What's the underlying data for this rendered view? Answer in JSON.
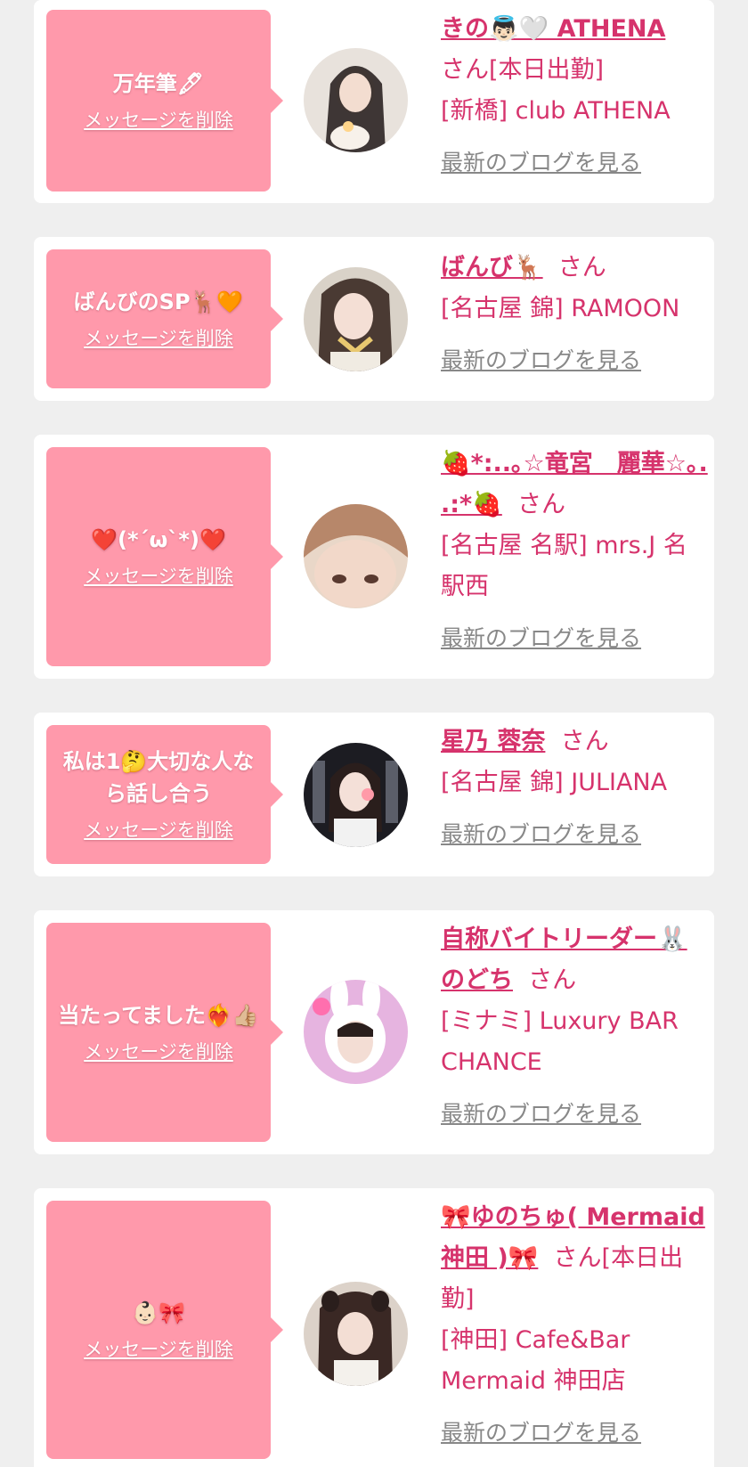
{
  "delete_label": "メッセージを削除",
  "blog_label": "最新のブログを見る",
  "colors": {
    "accent": "#d6336c",
    "bubble": "#ff99ab",
    "background": "#efefef",
    "link_gray": "#888888"
  },
  "entries": [
    {
      "message": "万年筆🖋",
      "name": "きの👼🏻🤍 ATHENA",
      "suffix": "さん[本日出勤]",
      "shop": "[新橋] club ATHENA"
    },
    {
      "message": "ばんびのSP🦌🧡",
      "name": "ばんび🦌",
      "suffix": "さん",
      "shop": "[名古屋 錦] RAMOON"
    },
    {
      "message": "❤️(*´ω`*)❤️",
      "name": "🍓*:..｡☆竜宮　麗華☆｡. .:*🍓",
      "suffix": "さん",
      "shop": "[名古屋 名駅] mrs.J 名駅西"
    },
    {
      "message": "私は1🤔大切な人なら話し合う",
      "name": "星乃 蓉奈",
      "suffix": "さん",
      "shop": "[名古屋 錦] JULIANA"
    },
    {
      "message": "当たってました❤️‍🔥👍🏼",
      "name": "自称バイトリーダー🐰のどち",
      "suffix": "さん",
      "shop": "[ミナミ] Luxury BAR CHANCE"
    },
    {
      "message": "👶🏻🎀",
      "name": "🎀ゆのちゅ( Mermaid 神田 )🎀",
      "suffix": "さん[本日出勤]",
      "shop": "[神田] Cafe&Bar Mermaid 神田店"
    }
  ]
}
